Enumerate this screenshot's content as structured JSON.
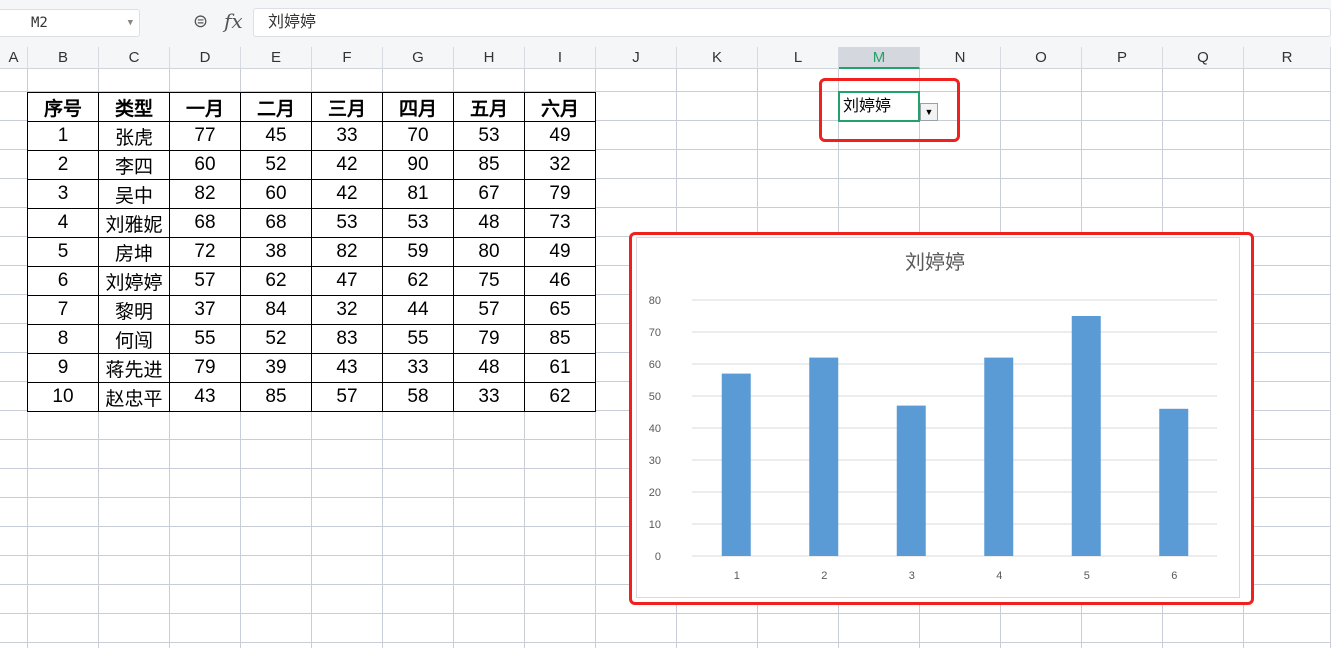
{
  "formula_bar": {
    "name_box": "M2",
    "formula": "刘婷婷",
    "fx_label": "fx"
  },
  "columns": [
    "A",
    "B",
    "C",
    "D",
    "E",
    "F",
    "G",
    "H",
    "I",
    "J",
    "K",
    "L",
    "M",
    "N",
    "O",
    "P",
    "Q",
    "R"
  ],
  "selected_column": "M",
  "table": {
    "headers": [
      "序号",
      "类型",
      "一月",
      "二月",
      "三月",
      "四月",
      "五月",
      "六月"
    ],
    "rows": [
      [
        "1",
        "张虎",
        "77",
        "45",
        "33",
        "70",
        "53",
        "49"
      ],
      [
        "2",
        "李四",
        "60",
        "52",
        "42",
        "90",
        "85",
        "32"
      ],
      [
        "3",
        "吴中",
        "82",
        "60",
        "42",
        "81",
        "67",
        "79"
      ],
      [
        "4",
        "刘雅妮",
        "68",
        "68",
        "53",
        "53",
        "48",
        "73"
      ],
      [
        "5",
        "房坤",
        "72",
        "38",
        "82",
        "59",
        "80",
        "49"
      ],
      [
        "6",
        "刘婷婷",
        "57",
        "62",
        "47",
        "62",
        "75",
        "46"
      ],
      [
        "7",
        "黎明",
        "37",
        "84",
        "32",
        "44",
        "57",
        "65"
      ],
      [
        "8",
        "何闯",
        "55",
        "52",
        "83",
        "55",
        "79",
        "85"
      ],
      [
        "9",
        "蒋先进",
        "79",
        "39",
        "43",
        "33",
        "48",
        "61"
      ],
      [
        "10",
        "赵忠平",
        "43",
        "85",
        "57",
        "58",
        "33",
        "62"
      ]
    ]
  },
  "dropdown_cell": {
    "value": "刘婷婷"
  },
  "chart_data": {
    "type": "bar",
    "title": "刘婷婷",
    "categories": [
      "1",
      "2",
      "3",
      "4",
      "5",
      "6"
    ],
    "values": [
      57,
      62,
      47,
      62,
      75,
      46
    ],
    "ylim": [
      0,
      80
    ],
    "yticks": [
      0,
      10,
      20,
      30,
      40,
      50,
      60,
      70,
      80
    ],
    "grid": true,
    "bar_color": "#5b9bd5",
    "xlabel": "",
    "ylabel": ""
  },
  "colors": {
    "highlight": "#f0201c",
    "selection": "#1fa36a"
  }
}
